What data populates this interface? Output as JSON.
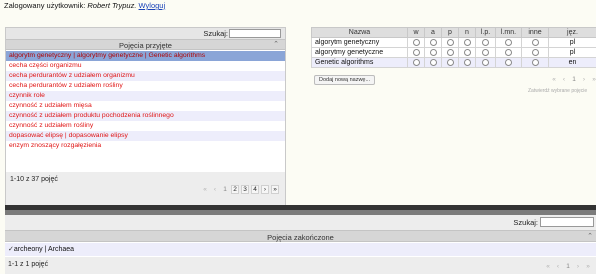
{
  "user": {
    "label": "Zalogowany użytkownik:",
    "name": "Robert Trypuz.",
    "logout": "Wyloguj"
  },
  "left_panel": {
    "search_label": "Szukaj:",
    "search_value": "",
    "header": "Pojęcia przyjęte",
    "sort_caret": "⌃",
    "rows": [
      "algorytm genetyczny | algorytmy genetyczne | Genetic algorithms",
      "cecha części organizmu",
      "cecha perdurantów z udziałem organizmu",
      "cecha perdurantów z udziałem rośliny",
      "czynnik role",
      "czynność z udziałem mięsa",
      "czynność z udziałem produktu pochodzenia roślinnego",
      "czynność z udziałem rośliny",
      "dopasować elipsę | dopasowanie elipsy",
      "enzym znoszący rozgałęzienia"
    ],
    "count": "1-10 z 37 pojęć",
    "pager": {
      "first": "«",
      "prev": "‹",
      "pages": [
        "1",
        "2",
        "3",
        "4"
      ],
      "next": "›",
      "last": "»"
    }
  },
  "right_table": {
    "columns": [
      "Nazwa",
      "w",
      "a",
      "p",
      "n",
      "l.p.",
      "l.mn.",
      "inne",
      "jęz."
    ],
    "rows": [
      {
        "name": "algorytm genetyczny",
        "lang": "pl"
      },
      {
        "name": "algorytmy genetyczne",
        "lang": "pl"
      },
      {
        "name": "Genetic algorithms",
        "lang": "en"
      }
    ],
    "add_button": "Dodaj nową nazwę...",
    "pager": {
      "first": "«",
      "prev": "‹",
      "page": "1",
      "next": "›",
      "last": "»"
    },
    "approve_button": "Zatwierdź wybrane pojęcie"
  },
  "bottom_panel": {
    "search_label": "Szukaj:",
    "search_value": "",
    "header": "Pojęcia zakończone",
    "sort_caret": "⌃",
    "row": "archeony | Archaea",
    "check": "✓",
    "count": "1-1 z 1 pojęć",
    "pager": {
      "first": "«",
      "prev": "‹",
      "page": "1",
      "next": "›",
      "last": "»"
    }
  }
}
